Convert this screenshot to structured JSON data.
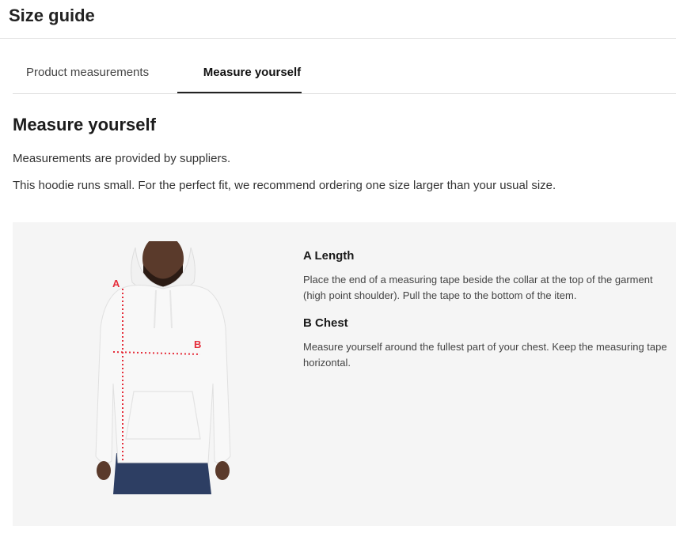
{
  "header": {
    "title": "Size guide"
  },
  "tabs": [
    {
      "label": "Product measurements",
      "active": false
    },
    {
      "label": "Measure yourself",
      "active": true
    }
  ],
  "section": {
    "heading": "Measure yourself",
    "note": "Measurements are provided by suppliers.",
    "fit_note": "This hoodie runs small. For the perfect fit, we recommend ordering one size larger than your usual size."
  },
  "figure": {
    "label_a": "A",
    "label_b": "B",
    "colors": {
      "hoodie": "#f8f8f8",
      "skin": "#5a3a2b",
      "jeans": "#2d3e63",
      "marker": "#e52d3a"
    }
  },
  "measurements": [
    {
      "title": "A Length",
      "description": "Place the end of a measuring tape beside the collar at the top of the garment (high point shoulder). Pull the tape to the bottom of the item."
    },
    {
      "title": "B Chest",
      "description": "Measure yourself around the fullest part of your chest. Keep the measuring tape horizontal."
    }
  ]
}
